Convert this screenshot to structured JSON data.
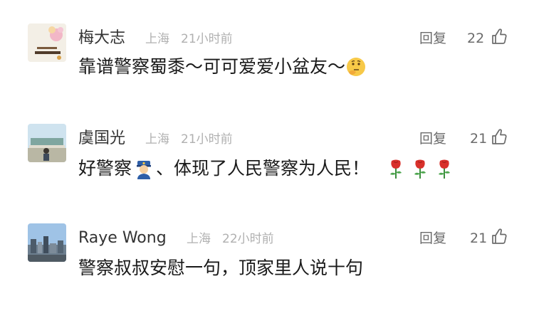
{
  "comments": [
    {
      "name": "梅大志",
      "location": "上海",
      "time": "21小时前",
      "reply_label": "回复",
      "likes": "22",
      "text_before": "靠谱警察蜀黍～可可爱爱小盆友～",
      "emoji": "thinking-face-icon"
    },
    {
      "name": "虞国光",
      "location": "上海",
      "time": "21小时前",
      "reply_label": "回复",
      "likes": "21",
      "text_before": "好警察",
      "text_after": "、体现了人民警察为人民！",
      "emoji": "police-officer-icon",
      "trailing_emoji": "rose-icon"
    },
    {
      "name": "Raye Wong",
      "location": "上海",
      "time": "22小时前",
      "reply_label": "回复",
      "likes": "21",
      "text_before": "警察叔叔安慰一句，顶家里人说十句"
    }
  ],
  "colors": {
    "name": "#333333",
    "meta": "#b0b0b0",
    "action": "#6b6b6b",
    "body_text": "#1a1a1a"
  }
}
